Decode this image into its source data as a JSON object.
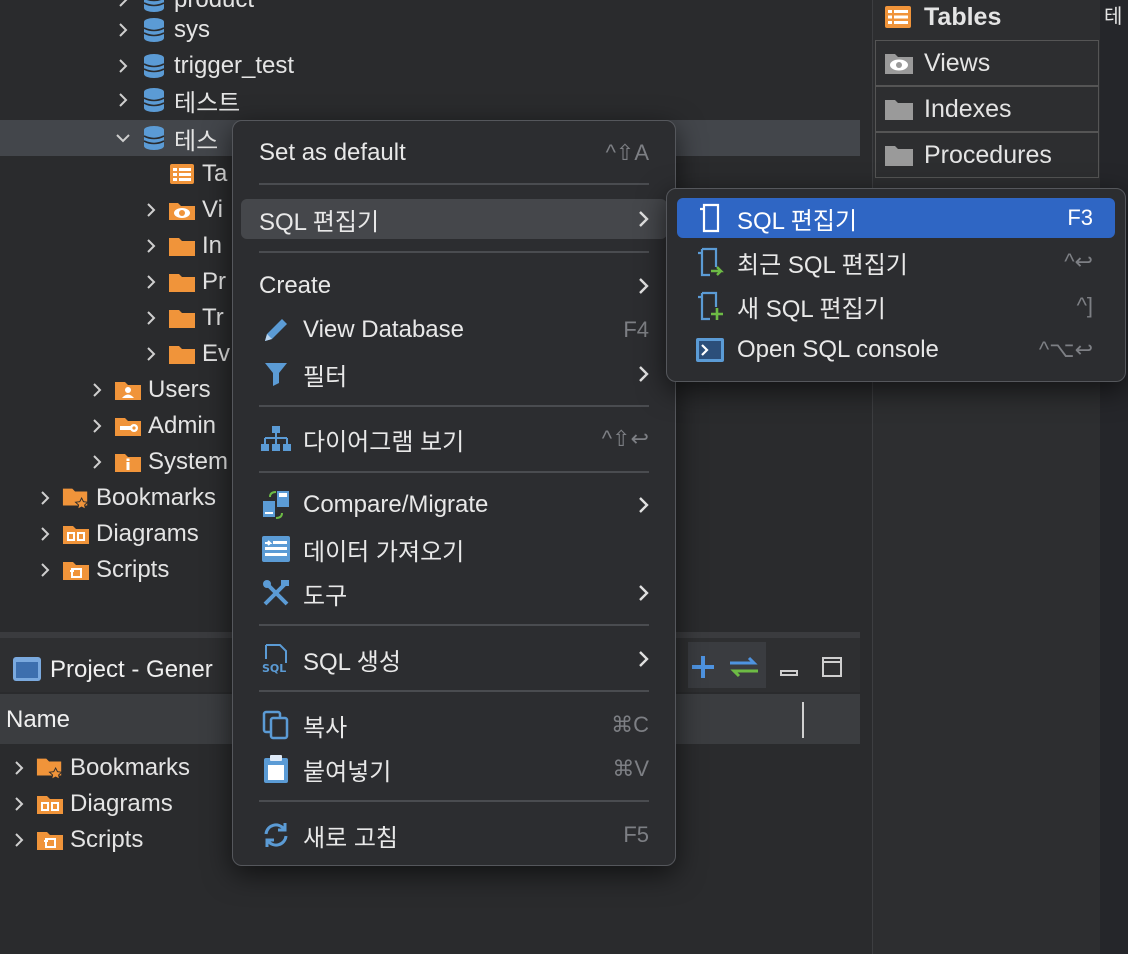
{
  "navigator": {
    "items": [
      {
        "label": "product",
        "icon": "database-icon",
        "level": 2
      },
      {
        "label": "sys",
        "icon": "database-icon",
        "level": 2
      },
      {
        "label": "trigger_test",
        "icon": "database-icon",
        "level": 2
      },
      {
        "label": "테스트",
        "icon": "database-icon",
        "level": 2
      },
      {
        "label": "테스",
        "icon": "database-icon",
        "level": 2
      },
      {
        "label": "Ta",
        "icon": "table-folder-icon",
        "level": 3
      },
      {
        "label": "Vi",
        "icon": "views-folder-icon",
        "level": 3
      },
      {
        "label": "In",
        "icon": "folder-icon",
        "level": 3
      },
      {
        "label": "Pr",
        "icon": "folder-icon",
        "level": 3
      },
      {
        "label": "Tr",
        "icon": "folder-icon",
        "level": 3
      },
      {
        "label": "Ev",
        "icon": "folder-icon",
        "level": 3
      },
      {
        "label": "Users",
        "icon": "users-folder-icon",
        "level": 2
      },
      {
        "label": "Admin",
        "icon": "admin-folder-icon",
        "level": 2
      },
      {
        "label": "System",
        "icon": "info-folder-icon",
        "level": 2
      },
      {
        "label": "Bookmarks",
        "icon": "bookmarks-icon",
        "level": 1
      },
      {
        "label": "Diagrams",
        "icon": "diagrams-icon",
        "level": 1
      },
      {
        "label": "Scripts",
        "icon": "scripts-icon",
        "level": 1
      }
    ]
  },
  "project": {
    "title": "Project - Gener",
    "column_name": "Name",
    "items": [
      {
        "label": "Bookmarks",
        "icon": "bookmarks-icon"
      },
      {
        "label": "Diagrams",
        "icon": "diagrams-icon"
      },
      {
        "label": "Scripts",
        "icon": "scripts-icon"
      }
    ]
  },
  "right_panel": {
    "tabs": [
      {
        "label": "Tables",
        "icon": "table-icon",
        "bold": true
      },
      {
        "label": "Views",
        "icon": "eye-icon"
      },
      {
        "label": "Indexes",
        "icon": "folder-icon"
      },
      {
        "label": "Procedures",
        "icon": "folder-icon"
      }
    ],
    "edge_label": "테"
  },
  "context_menu": {
    "items": [
      {
        "label": "Set as default",
        "shortcut": "^⇧A"
      },
      {
        "label": "SQL 편집기",
        "submenu": true
      },
      {
        "label": "Create",
        "submenu": true
      },
      {
        "label": "View Database",
        "shortcut": "F4"
      },
      {
        "label": "필터",
        "submenu": true
      },
      {
        "label": "다이어그램 보기",
        "shortcut": "^⇧↩"
      },
      {
        "label": "Compare/Migrate",
        "submenu": true
      },
      {
        "label": "데이터 가져오기"
      },
      {
        "label": "도구",
        "submenu": true
      },
      {
        "label": "SQL 생성",
        "submenu": true
      },
      {
        "label": "복사",
        "shortcut": "⌘C"
      },
      {
        "label": "붙여넣기",
        "shortcut": "⌘V"
      },
      {
        "label": "새로 고침",
        "shortcut": "F5"
      }
    ]
  },
  "submenu": {
    "items": [
      {
        "label": "SQL 편집기",
        "shortcut": "F3"
      },
      {
        "label": "최근 SQL 편집기",
        "shortcut": "^↩"
      },
      {
        "label": "새 SQL 편집기",
        "shortcut": "^]"
      },
      {
        "label": "Open SQL console",
        "shortcut": "^⌥↩"
      }
    ]
  },
  "colors": {
    "accent": "#2f66c4",
    "folder": "#f0943a",
    "database": "#5b9bd5",
    "background": "#2a2b2d"
  }
}
